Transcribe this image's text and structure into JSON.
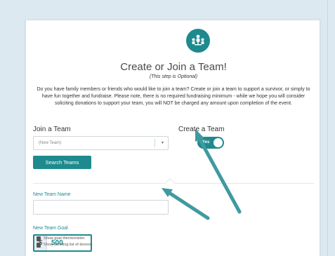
{
  "page": {
    "title": "Create or Join a Team!",
    "subtitle": "(This step is Optional)",
    "description": "Do you have family members or friends who would like to join a team? Create or join a team to support a survivor, or simply to have fun together and fundraise. Please note, there is no required fundraising minimum - while we hope you will consider soliciting donations to support your team, you will NOT be charged any amount upon completion of the event."
  },
  "join": {
    "heading": "Join a Team",
    "select_value": "(New Team)",
    "search_button": "Search Teams"
  },
  "create": {
    "heading": "Create a Team",
    "toggle_label": "Yes",
    "toggle_on": true
  },
  "new_team": {
    "name_label": "New Team Name",
    "name_value": "",
    "goal_label": "New Team Goal",
    "currency": "$",
    "goal_value": "500"
  },
  "options": [
    {
      "label": "Show goal thermometer."
    },
    {
      "label": "Show scrolling list of donors."
    }
  ],
  "colors": {
    "accent": "#1e8a8e",
    "arrow": "#3f9aa0",
    "background": "#dde9f1"
  },
  "icons": {
    "logo": "team-people-icon",
    "select_caret": "caret-down-icon"
  }
}
